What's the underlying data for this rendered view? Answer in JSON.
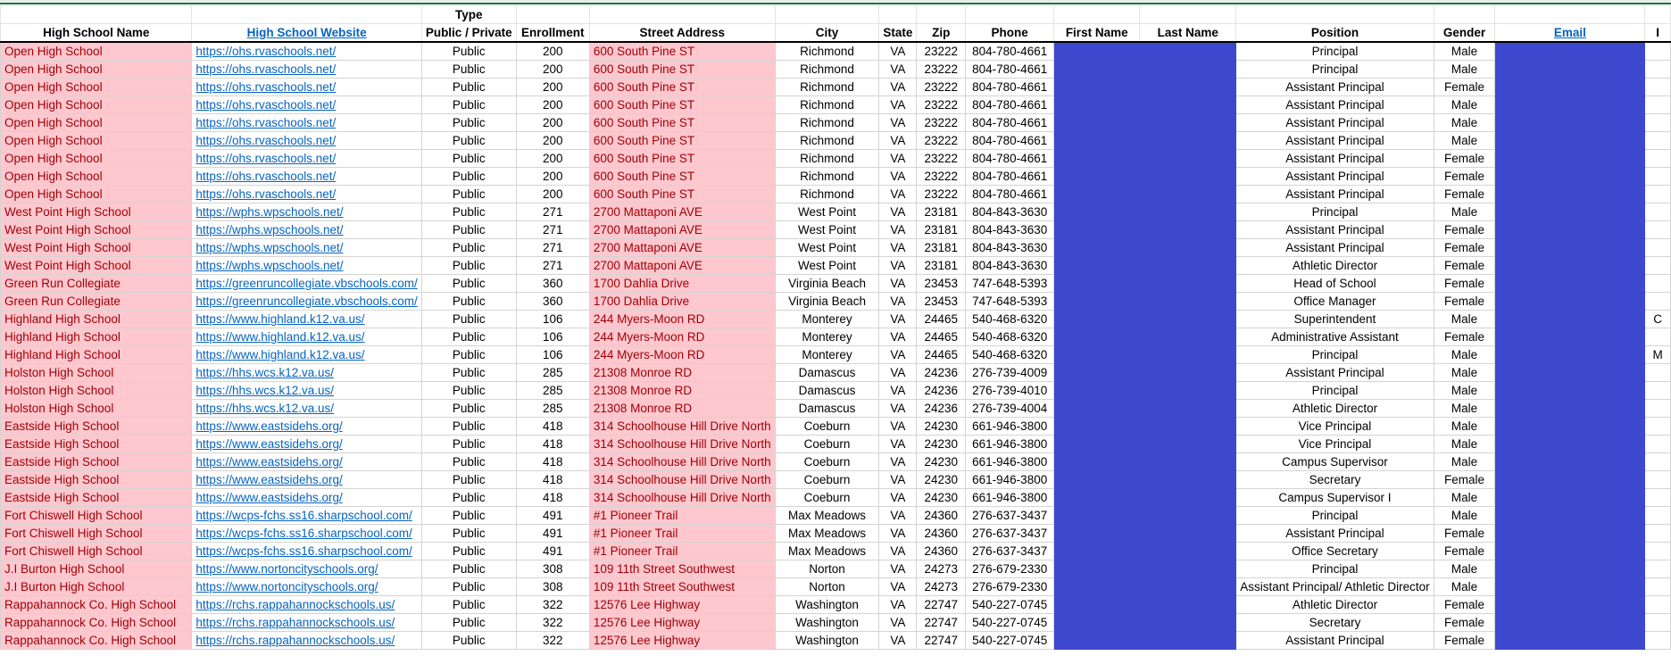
{
  "header": {
    "type_label": "Type",
    "columns": [
      "High School Name",
      "High School Website",
      "Public / Private",
      "Enrollment",
      "Street Address",
      "City",
      "State",
      "Zip",
      "Phone",
      "First Name",
      "Last Name",
      "Position",
      "Gender",
      "Email",
      "I"
    ]
  },
  "colors": {
    "highlight_pink": "#ffc7ce",
    "highlight_pink_text": "#9c0006",
    "redaction_blue": "#3d48cf",
    "link": "#0563c1"
  },
  "rows": [
    [
      "Open High School",
      "https://ohs.rvaschools.net/",
      "Public",
      "200",
      "600 South Pine ST",
      "Richmond",
      "VA",
      "23222",
      "804-780-4661",
      "",
      "",
      "Principal",
      "Male",
      "",
      ""
    ],
    [
      "Open High School",
      "https://ohs.rvaschools.net/",
      "Public",
      "200",
      "600 South Pine ST",
      "Richmond",
      "VA",
      "23222",
      "804-780-4661",
      "",
      "",
      "Principal",
      "Male",
      "",
      ""
    ],
    [
      "Open High School",
      "https://ohs.rvaschools.net/",
      "Public",
      "200",
      "600 South Pine ST",
      "Richmond",
      "VA",
      "23222",
      "804-780-4661",
      "",
      "",
      "Assistant Principal",
      "Female",
      "",
      ""
    ],
    [
      "Open High School",
      "https://ohs.rvaschools.net/",
      "Public",
      "200",
      "600 South Pine ST",
      "Richmond",
      "VA",
      "23222",
      "804-780-4661",
      "",
      "",
      "Assistant Principal",
      "Male",
      "",
      ""
    ],
    [
      "Open High School",
      "https://ohs.rvaschools.net/",
      "Public",
      "200",
      "600 South Pine ST",
      "Richmond",
      "VA",
      "23222",
      "804-780-4661",
      "",
      "",
      "Assistant Principal",
      "Male",
      "",
      ""
    ],
    [
      "Open High School",
      "https://ohs.rvaschools.net/",
      "Public",
      "200",
      "600 South Pine ST",
      "Richmond",
      "VA",
      "23222",
      "804-780-4661",
      "",
      "",
      "Assistant Principal",
      "Male",
      "",
      ""
    ],
    [
      "Open High School",
      "https://ohs.rvaschools.net/",
      "Public",
      "200",
      "600 South Pine ST",
      "Richmond",
      "VA",
      "23222",
      "804-780-4661",
      "",
      "",
      "Assistant Principal",
      "Female",
      "",
      ""
    ],
    [
      "Open High School",
      "https://ohs.rvaschools.net/",
      "Public",
      "200",
      "600 South Pine ST",
      "Richmond",
      "VA",
      "23222",
      "804-780-4661",
      "",
      "",
      "Assistant Principal",
      "Female",
      "",
      ""
    ],
    [
      "Open High School",
      "https://ohs.rvaschools.net/",
      "Public",
      "200",
      "600 South Pine ST",
      "Richmond",
      "VA",
      "23222",
      "804-780-4661",
      "",
      "",
      "Assistant Principal",
      "Female",
      "",
      ""
    ],
    [
      "West Point High School",
      "https://wphs.wpschools.net/",
      "Public",
      "271",
      "2700 Mattaponi AVE",
      "West Point",
      "VA",
      "23181",
      "804-843-3630",
      "",
      "",
      "Principal",
      "Male",
      "",
      ""
    ],
    [
      "West Point High School",
      "https://wphs.wpschools.net/",
      "Public",
      "271",
      "2700 Mattaponi AVE",
      "West Point",
      "VA",
      "23181",
      "804-843-3630",
      "",
      "",
      "Assistant Principal",
      "Female",
      "",
      ""
    ],
    [
      "West Point High School",
      "https://wphs.wpschools.net/",
      "Public",
      "271",
      "2700 Mattaponi AVE",
      "West Point",
      "VA",
      "23181",
      "804-843-3630",
      "",
      "",
      "Assistant Principal",
      "Female",
      "",
      ""
    ],
    [
      "West Point High School",
      "https://wphs.wpschools.net/",
      "Public",
      "271",
      "2700 Mattaponi AVE",
      "West Point",
      "VA",
      "23181",
      "804-843-3630",
      "",
      "",
      "Athletic Director",
      "Female",
      "",
      ""
    ],
    [
      "Green Run Collegiate",
      "https://greenruncollegiate.vbschools.com/",
      "Public",
      "360",
      "1700 Dahlia Drive",
      "Virginia Beach",
      "VA",
      "23453",
      "747-648-5393",
      "",
      "",
      "Head of School",
      "Female",
      "",
      ""
    ],
    [
      "Green Run Collegiate",
      "https://greenruncollegiate.vbschools.com/",
      "Public",
      "360",
      "1700 Dahlia Drive",
      "Virginia Beach",
      "VA",
      "23453",
      "747-648-5393",
      "",
      "",
      "Office Manager",
      "Female",
      "",
      ""
    ],
    [
      "Highland High School",
      "https://www.highland.k12.va.us/",
      "Public",
      "106",
      "244 Myers-Moon RD",
      "Monterey",
      "VA",
      "24465",
      "540-468-6320",
      "",
      "",
      "Superintendent",
      "Male",
      "",
      "C"
    ],
    [
      "Highland High School",
      "https://www.highland.k12.va.us/",
      "Public",
      "106",
      "244 Myers-Moon RD",
      "Monterey",
      "VA",
      "24465",
      "540-468-6320",
      "",
      "",
      "Administrative Assistant",
      "Female",
      "",
      ""
    ],
    [
      "Highland High School",
      "https://www.highland.k12.va.us/",
      "Public",
      "106",
      "244 Myers-Moon RD",
      "Monterey",
      "VA",
      "24465",
      "540-468-6320",
      "",
      "",
      "Principal",
      "Male",
      "",
      "M"
    ],
    [
      "Holston High School",
      "https://hhs.wcs.k12.va.us/",
      "Public",
      "285",
      "21308 Monroe RD",
      "Damascus",
      "VA",
      "24236",
      "276-739-4009",
      "",
      "",
      "Assistant Principal",
      "Male",
      "",
      ""
    ],
    [
      "Holston High School",
      "https://hhs.wcs.k12.va.us/",
      "Public",
      "285",
      "21308 Monroe RD",
      "Damascus",
      "VA",
      "24236",
      "276-739-4010",
      "",
      "",
      "Principal",
      "Male",
      "",
      ""
    ],
    [
      "Holston High School",
      "https://hhs.wcs.k12.va.us/",
      "Public",
      "285",
      "21308 Monroe RD",
      "Damascus",
      "VA",
      "24236",
      "276-739-4004",
      "",
      "",
      "Athletic Director",
      "Male",
      "",
      ""
    ],
    [
      "Eastside High School",
      "https://www.eastsidehs.org/",
      "Public",
      "418",
      "314 Schoolhouse Hill Drive North",
      "Coeburn",
      "VA",
      "24230",
      "661-946-3800",
      "",
      "",
      "Vice Principal",
      "Male",
      "",
      ""
    ],
    [
      "Eastside High School",
      "https://www.eastsidehs.org/",
      "Public",
      "418",
      "314 Schoolhouse Hill Drive North",
      "Coeburn",
      "VA",
      "24230",
      "661-946-3800",
      "",
      "",
      "Vice Principal",
      "Male",
      "",
      ""
    ],
    [
      "Eastside High School",
      "https://www.eastsidehs.org/",
      "Public",
      "418",
      "314 Schoolhouse Hill Drive North",
      "Coeburn",
      "VA",
      "24230",
      "661-946-3800",
      "",
      "",
      "Campus Supervisor",
      "Male",
      "",
      ""
    ],
    [
      "Eastside High School",
      "https://www.eastsidehs.org/",
      "Public",
      "418",
      "314 Schoolhouse Hill Drive North",
      "Coeburn",
      "VA",
      "24230",
      "661-946-3800",
      "",
      "",
      "Secretary",
      "Female",
      "",
      ""
    ],
    [
      "Eastside High School",
      "https://www.eastsidehs.org/",
      "Public",
      "418",
      "314 Schoolhouse Hill Drive North",
      "Coeburn",
      "VA",
      "24230",
      "661-946-3800",
      "",
      "",
      "Campus Supervisor I",
      "Male",
      "",
      ""
    ],
    [
      "Fort Chiswell High School",
      "https://wcps-fchs.ss16.sharpschool.com/",
      "Public",
      "491",
      "#1 Pioneer Trail",
      "Max Meadows",
      "VA",
      "24360",
      "276-637-3437",
      "",
      "",
      "Principal",
      "Male",
      "",
      ""
    ],
    [
      "Fort Chiswell High School",
      "https://wcps-fchs.ss16.sharpschool.com/",
      "Public",
      "491",
      "#1 Pioneer Trail",
      "Max Meadows",
      "VA",
      "24360",
      "276-637-3437",
      "",
      "",
      "Assistant Principal",
      "Female",
      "",
      ""
    ],
    [
      "Fort Chiswell High School",
      "https://wcps-fchs.ss16.sharpschool.com/",
      "Public",
      "491",
      "#1 Pioneer Trail",
      "Max Meadows",
      "VA",
      "24360",
      "276-637-3437",
      "",
      "",
      "Office Secretary",
      "Female",
      "",
      ""
    ],
    [
      "J.I Burton High School",
      "https://www.nortoncityschools.org/",
      "Public",
      "308",
      "109 11th Street Southwest",
      "Norton",
      "VA",
      "24273",
      "276-679-2330",
      "",
      "",
      "Principal",
      "Male",
      "",
      ""
    ],
    [
      "J.I Burton High School",
      "https://www.nortoncityschools.org/",
      "Public",
      "308",
      "109 11th Street Southwest",
      "Norton",
      "VA",
      "24273",
      "276-679-2330",
      "",
      "",
      "Assistant Principal/ Athletic Director",
      "Male",
      "",
      ""
    ],
    [
      "Rappahannock Co. High School",
      "https://rchs.rappahannockschools.us/",
      "Public",
      "322",
      "12576 Lee Highway",
      "Washington",
      "VA",
      "22747",
      "540-227-0745",
      "",
      "",
      "Athletic Director",
      "Female",
      "",
      ""
    ],
    [
      "Rappahannock Co. High School",
      "https://rchs.rappahannockschools.us/",
      "Public",
      "322",
      "12576 Lee Highway",
      "Washington",
      "VA",
      "22747",
      "540-227-0745",
      "",
      "",
      "Secretary",
      "Female",
      "",
      ""
    ],
    [
      "Rappahannock Co. High School",
      "https://rchs.rappahannockschools.us/",
      "Public",
      "322",
      "12576 Lee Highway",
      "Washington",
      "VA",
      "22747",
      "540-227-0745",
      "",
      "",
      "Assistant Principal",
      "Female",
      "",
      ""
    ]
  ]
}
